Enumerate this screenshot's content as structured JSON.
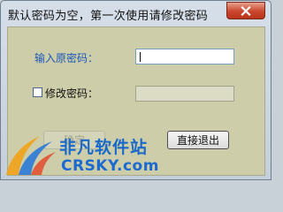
{
  "window": {
    "title": "默认密码为空，第一次使用请修改密码",
    "close_icon": "close-icon"
  },
  "form": {
    "original_password_label": "输入原密码：",
    "original_password_value": "",
    "change_password_label": "修改密码：",
    "change_password_checked": false,
    "new_password_value": ""
  },
  "buttons": {
    "ok_label": "确定",
    "exit_label": "直接退出"
  },
  "watermark": {
    "brand": "非凡软件站",
    "site": "CRSKY.com"
  }
}
